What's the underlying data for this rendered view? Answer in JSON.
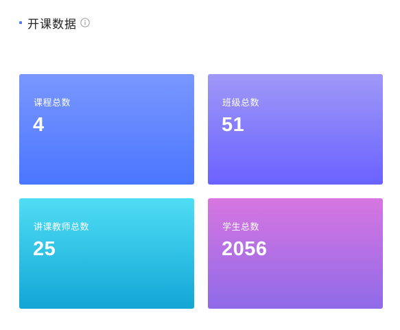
{
  "section": {
    "title": "开课数据",
    "info_icon": "info-circle-icon",
    "accent_color": "#4f7cff"
  },
  "cards": [
    {
      "label": "课程总数",
      "value": "4",
      "gradient": [
        "#7a97ff",
        "#4a76ff"
      ]
    },
    {
      "label": "班级总数",
      "value": "51",
      "gradient": [
        "#a098f7",
        "#6a62ff"
      ]
    },
    {
      "label": "讲课教师总数",
      "value": "25",
      "gradient": [
        "#4fddf4",
        "#12a6d6"
      ]
    },
    {
      "label": "学生总数",
      "value": "2056",
      "gradient": [
        "#d776e0",
        "#8f6ae8"
      ]
    }
  ]
}
